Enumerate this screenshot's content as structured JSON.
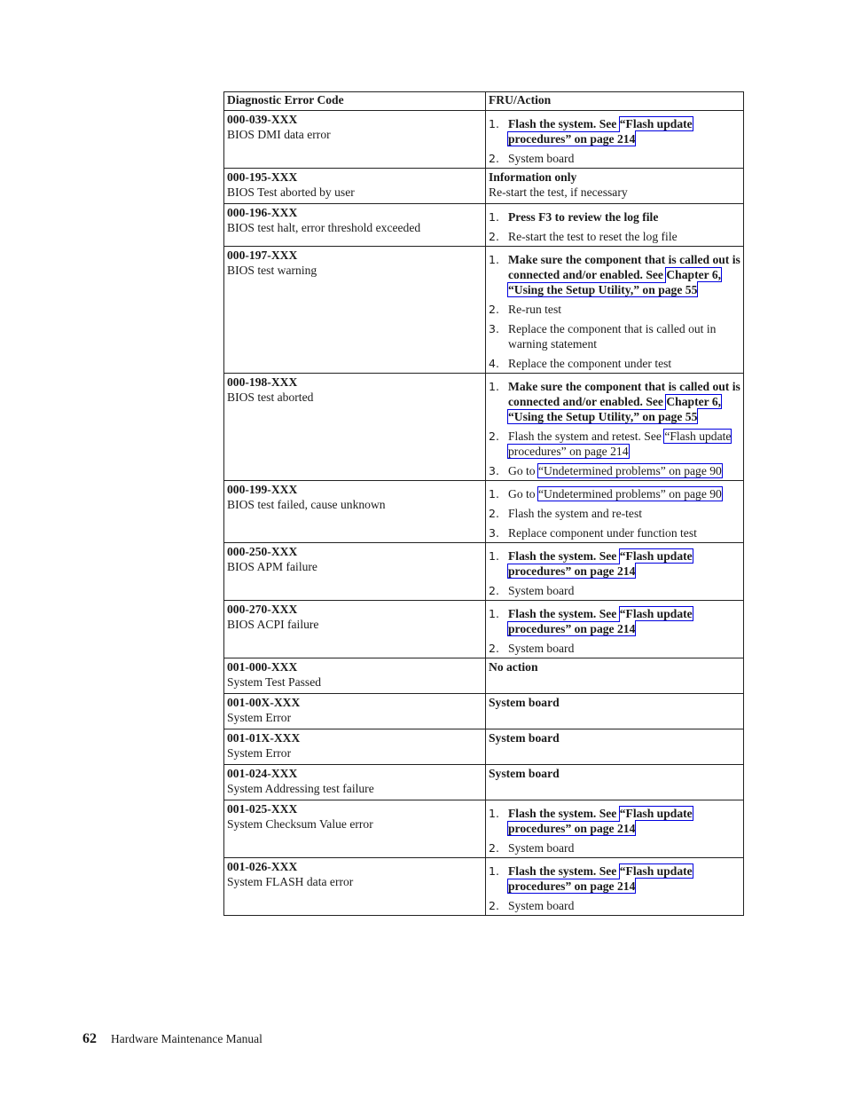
{
  "table": {
    "headers": [
      "Diagnostic Error Code",
      "FRU/Action"
    ],
    "rows": [
      {
        "code": "000-039-XXX",
        "desc": "BIOS DMI data error",
        "steps": [
          {
            "bold": true,
            "pre": "Flash the system. See ",
            "link": "“Flash update procedures” on page 214",
            "post": ""
          },
          {
            "bold": false,
            "pre": "System board",
            "link": "",
            "post": ""
          }
        ]
      },
      {
        "code": "000-195-XXX",
        "desc": "BIOS Test aborted by user",
        "plain_bold": "Information only",
        "plain_text": "Re-start the test, if necessary"
      },
      {
        "code": "000-196-XXX",
        "desc": "BIOS test halt, error threshold exceeded",
        "steps": [
          {
            "bold": true,
            "pre": "Press F3 to review the log file",
            "link": "",
            "post": ""
          },
          {
            "bold": false,
            "pre": "Re-start the test to reset the log file",
            "link": "",
            "post": ""
          }
        ]
      },
      {
        "code": "000-197-XXX",
        "desc": "BIOS test warning",
        "steps": [
          {
            "bold": true,
            "pre": "Make sure the component that is called out is connected and/or enabled. See ",
            "link": "Chapter 6, “Using the Setup Utility,” on page 55",
            "post": ""
          },
          {
            "bold": false,
            "pre": "Re-run test",
            "link": "",
            "post": ""
          },
          {
            "bold": false,
            "pre": "Replace the component that is called out in warning statement",
            "link": "",
            "post": ""
          },
          {
            "bold": false,
            "pre": "Replace the component under test",
            "link": "",
            "post": ""
          }
        ]
      },
      {
        "code": "000-198-XXX",
        "desc": "BIOS test aborted",
        "steps": [
          {
            "bold": true,
            "pre": "Make sure the component that is called out is connected and/or enabled. See ",
            "link": "Chapter 6, “Using the Setup Utility,” on page 55",
            "post": ""
          },
          {
            "bold": false,
            "pre": "Flash the system and retest. See ",
            "link": "“Flash update procedures” on page 214",
            "post": ""
          },
          {
            "bold": false,
            "pre": "Go to ",
            "link": "“Undetermined problems” on page 90",
            "post": ""
          }
        ]
      },
      {
        "code": "000-199-XXX",
        "desc": "BIOS test failed, cause unknown",
        "steps": [
          {
            "bold": false,
            "pre": "Go to ",
            "link": "“Undetermined problems” on page 90",
            "post": ""
          },
          {
            "bold": false,
            "pre": "Flash the system and re-test",
            "link": "",
            "post": ""
          },
          {
            "bold": false,
            "pre": "Replace component under function test",
            "link": "",
            "post": ""
          }
        ]
      },
      {
        "code": "000-250-XXX",
        "desc": "BIOS APM failure",
        "steps": [
          {
            "bold": true,
            "pre": "Flash the system. See ",
            "link": "“Flash update procedures” on page 214",
            "post": ""
          },
          {
            "bold": false,
            "pre": "System board",
            "link": "",
            "post": ""
          }
        ]
      },
      {
        "code": "000-270-XXX",
        "desc": "BIOS ACPI failure",
        "steps": [
          {
            "bold": true,
            "pre": "Flash the system. See ",
            "link": "“Flash update procedures” on page 214",
            "post": ""
          },
          {
            "bold": false,
            "pre": "System board",
            "link": "",
            "post": ""
          }
        ]
      },
      {
        "code": "001-000-XXX",
        "desc": "System Test Passed",
        "plain_bold": "No action"
      },
      {
        "code": "001-00X-XXX",
        "desc": "System Error",
        "plain_bold": "System board"
      },
      {
        "code": "001-01X-XXX",
        "desc": "System Error",
        "plain_bold": "System board"
      },
      {
        "code": "001-024-XXX",
        "desc": "System Addressing test failure",
        "plain_bold": "System board"
      },
      {
        "code": "001-025-XXX",
        "desc": "System Checksum Value error",
        "steps": [
          {
            "bold": true,
            "pre": "Flash the system. See ",
            "link": "“Flash update procedures” on page 214",
            "post": ""
          },
          {
            "bold": false,
            "pre": "System board",
            "link": "",
            "post": ""
          }
        ]
      },
      {
        "code": "001-026-XXX",
        "desc": "System FLASH data error",
        "steps": [
          {
            "bold": true,
            "pre": "Flash the system. See ",
            "link": "“Flash update procedures” on page 214",
            "post": ""
          },
          {
            "bold": false,
            "pre": "System board",
            "link": "",
            "post": ""
          }
        ]
      }
    ]
  },
  "footer": {
    "page_number": "62",
    "title": "Hardware Maintenance Manual"
  },
  "colors": {
    "link_box": "#0000e0",
    "border": "#222222",
    "text": "#1a1a1a"
  }
}
